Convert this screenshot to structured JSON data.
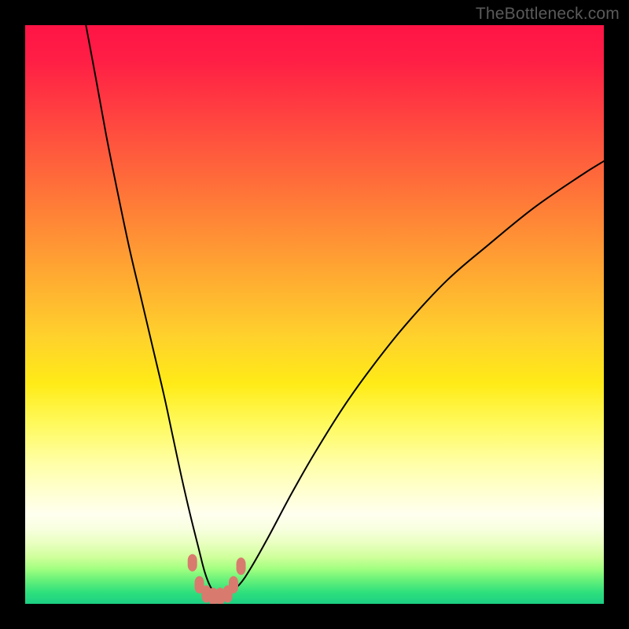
{
  "watermark": "TheBottleneck.com",
  "chart_data": {
    "type": "line",
    "title": "",
    "xlabel": "",
    "ylabel": "",
    "xlim": [
      0,
      100
    ],
    "ylim": [
      0,
      100
    ],
    "grid": false,
    "legend": false,
    "series": [
      {
        "name": "bottleneck-curve",
        "type": "curve",
        "x": [
          10.5,
          12,
          14,
          16,
          18,
          20,
          22,
          24,
          25.5,
          27,
          28.5,
          30,
          31,
          32,
          33,
          33.5,
          35,
          37,
          39,
          42,
          46,
          50,
          55,
          60,
          66,
          73,
          80,
          88,
          96,
          100
        ],
        "y": [
          100,
          92,
          81,
          71,
          61.5,
          53,
          44.5,
          36,
          29,
          22,
          15.5,
          9.5,
          5.6,
          3.0,
          1.8,
          1.6,
          1.8,
          3.3,
          6.2,
          11.5,
          19,
          26,
          34,
          41,
          48.5,
          56,
          62,
          68.5,
          74,
          76.5
        ]
      }
    ],
    "dots": [
      {
        "x": 28.9,
        "y": 7.1
      },
      {
        "x": 30.1,
        "y": 3.3
      },
      {
        "x": 31.3,
        "y": 1.7
      },
      {
        "x": 32.5,
        "y": 1.3
      },
      {
        "x": 33.7,
        "y": 1.3
      },
      {
        "x": 35.0,
        "y": 1.7
      },
      {
        "x": 36.0,
        "y": 3.3
      },
      {
        "x": 37.3,
        "y": 6.5
      }
    ],
    "dot_color": "#D97A6F",
    "curve_color": "#000000",
    "gradient_stops": [
      {
        "pos": 0,
        "color": "#FF1445"
      },
      {
        "pos": 0.3,
        "color": "#FF7838"
      },
      {
        "pos": 0.62,
        "color": "#FFEB17"
      },
      {
        "pos": 0.85,
        "color": "#FFFFEF"
      },
      {
        "pos": 1.0,
        "color": "#1CCF83"
      }
    ]
  }
}
